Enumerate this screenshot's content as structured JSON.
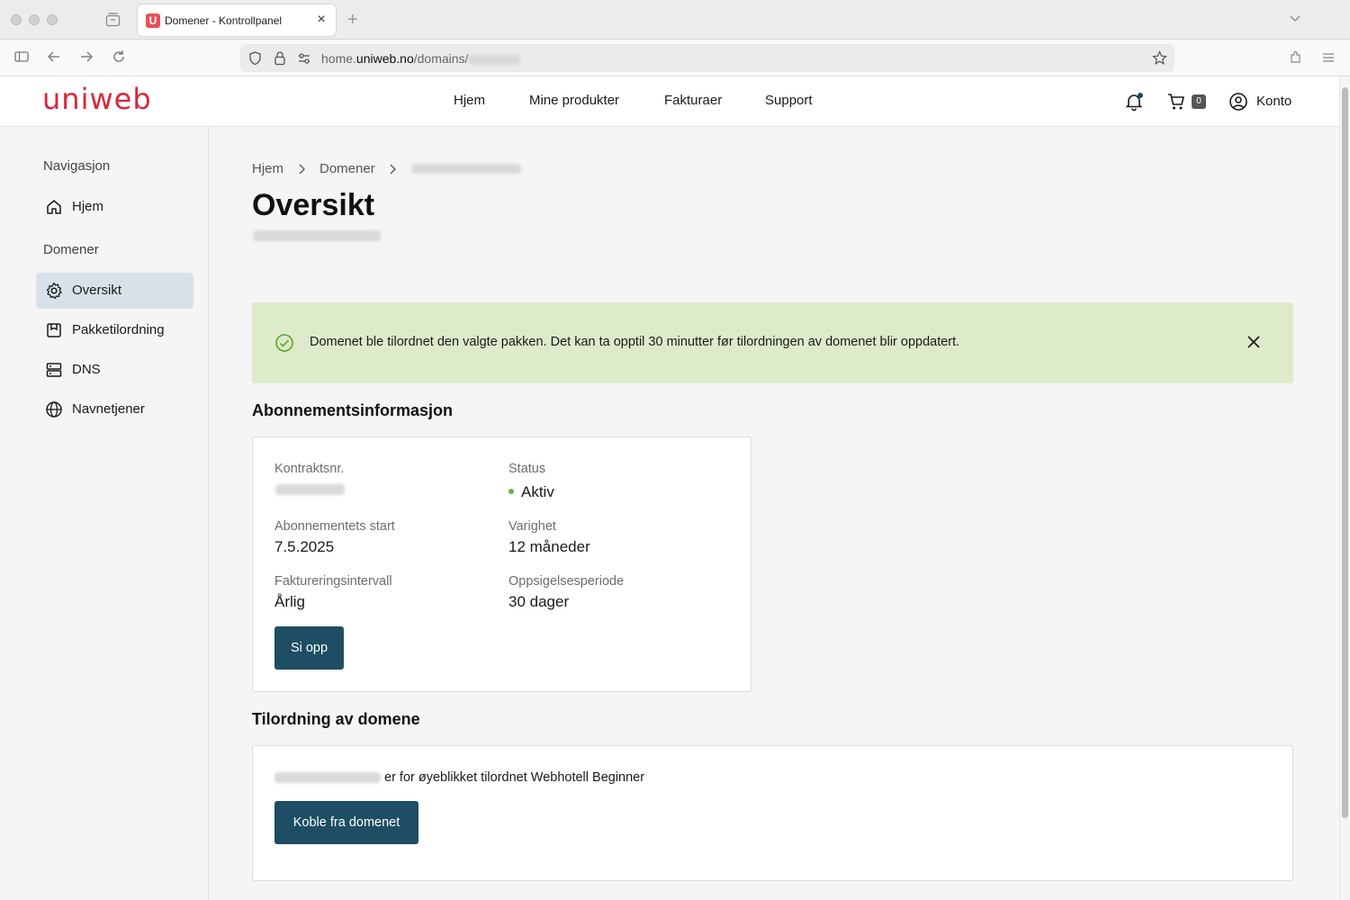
{
  "browser": {
    "tab_title": "Domener - Kontrollpanel",
    "tab_favicon_letter": "U",
    "url_prefix": "home.",
    "url_domain": "uniweb.no",
    "url_path": "/domains/"
  },
  "header": {
    "logo": "uniweb",
    "nav": [
      "Hjem",
      "Mine produkter",
      "Fakturaer",
      "Support"
    ],
    "cart_count": "0",
    "account_label": "Konto"
  },
  "sidebar": {
    "heading_nav": "Navigasjon",
    "item_home": "Hjem",
    "heading_domains": "Domener",
    "items": [
      "Oversikt",
      "Pakketilordning",
      "DNS",
      "Navnetjener"
    ]
  },
  "breadcrumb": [
    "Hjem",
    "Domener"
  ],
  "page_title": "Oversikt",
  "alert": {
    "message": "Domenet ble tilordnet den valgte pakken. Det kan ta opptil 30 minutter før tilordningen av domenet blir oppdatert."
  },
  "subscription": {
    "section_title": "Abonnementsinformasjon",
    "contract_label": "Kontraktsnr.",
    "status_label": "Status",
    "status_value": "Aktiv",
    "start_label": "Abonnementets start",
    "start_value": "7.5.2025",
    "duration_label": "Varighet",
    "duration_value": "12 måneder",
    "billing_label": "Faktureringsintervall",
    "billing_value": "Årlig",
    "notice_label": "Oppsigelsesperiode",
    "notice_value": "30 dager",
    "cancel_button": "Si opp"
  },
  "assignment": {
    "section_title": "Tilordning av domene",
    "text": "er for øyeblikket tilordnet Webhotell Beginner",
    "disconnect_button": "Koble fra domenet"
  }
}
